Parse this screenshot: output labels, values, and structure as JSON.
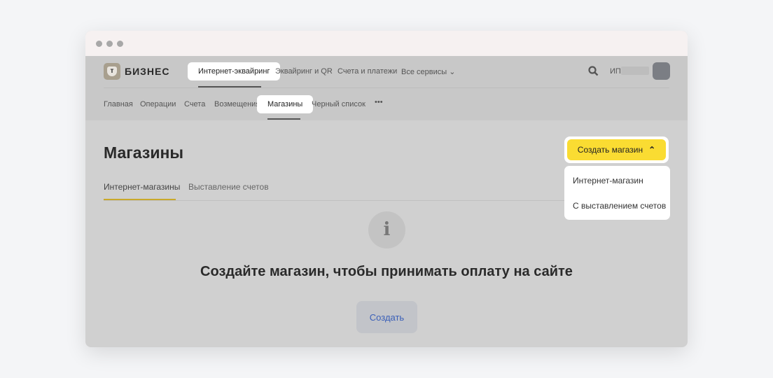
{
  "header": {
    "brand": "БИЗНЕС",
    "logo_letter": "т",
    "nav": [
      "Интернет-эквайринг",
      "Эквайринг и QR",
      "Счета и платежи",
      "Все сервисы"
    ],
    "user": "ИП"
  },
  "subnav": [
    "Главная",
    "Операции",
    "Счета",
    "Возмещения",
    "Магазины",
    "Черный список",
    "•••"
  ],
  "page": {
    "title": "Магазины",
    "tabs": [
      "Интернет-магазины",
      "Выставление счетов"
    ],
    "create_button": "Создать магазин",
    "menu": [
      "Интернет-магазин",
      "С выставлением счетов"
    ],
    "empty_title": "Создайте магазин, чтобы принимать оплату на сайте",
    "empty_button": "Создать",
    "info_glyph": "i"
  }
}
